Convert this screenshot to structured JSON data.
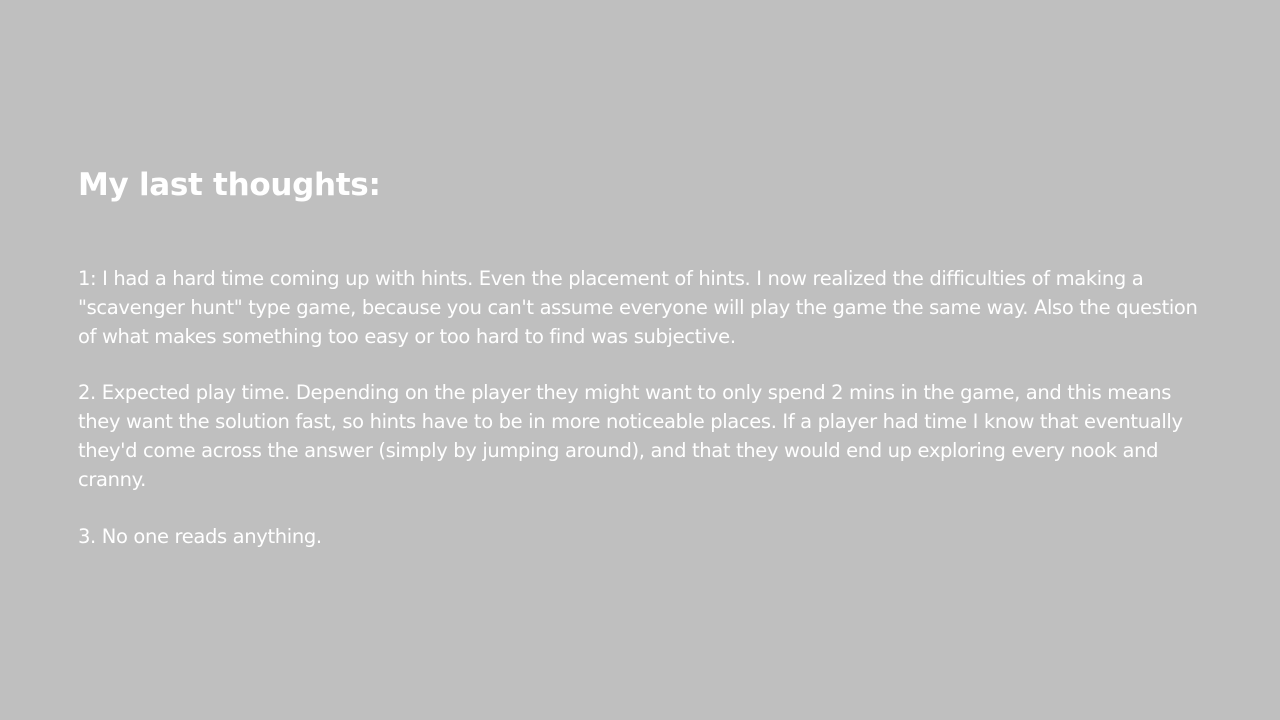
{
  "slide": {
    "title": "My last thoughts:",
    "paragraphs": [
      "1: I had a hard time coming up with hints. Even the placement of hints. I now realized the difficulties of making a \"scavenger hunt\" type game, because you can't assume everyone will play the game the same way. Also the question of what makes something too easy or too hard to find was subjective.",
      "2. Expected play time. Depending on the player they might want to only spend 2 mins in the game, and this means they want the solution fast, so hints have to be in more noticeable places. If a player had time I know that eventually they'd come across the answer (simply by jumping around), and that they would end up exploring every nook and cranny.",
      "3. No one reads anything."
    ]
  }
}
